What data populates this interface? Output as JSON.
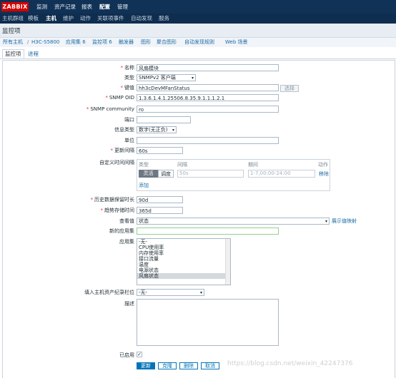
{
  "logo": "ZABBIX",
  "topnav": [
    "监测",
    "资产记录",
    "报表",
    "配置",
    "管理"
  ],
  "subnav": [
    "主机群组",
    "模板",
    "主机",
    "维护",
    "动作",
    "关联项事件",
    "自动发现",
    "服务"
  ],
  "page_title": "监控项",
  "hostbar": {
    "all_hosts": "所有主机",
    "sep": "/",
    "host": "H3C-S5800",
    "apps": "应用集 6",
    "items": "监控项 6",
    "triggers": "触发器",
    "graphs": "图形",
    "screens": "聚合图形",
    "discovery": "自动发现规则",
    "web": "Web 场景"
  },
  "tabs": {
    "item": "监控项",
    "process": "进程"
  },
  "form": {
    "name_label": "名称",
    "name_value": "风扇模块",
    "type_label": "类型",
    "type_value": "SNMPv2 客户端",
    "key_label": "键值",
    "key_value": "hh3cDevMFanStatus",
    "key_select": "选择",
    "oid_label": "SNMP OID",
    "oid_value": "1.3.6.1.4.1.25506.8.35.9.1.1.1.2.1",
    "community_label": "SNMP community",
    "community_value": "ro",
    "port_label": "端口",
    "port_value": "",
    "info_type_label": "信息类型",
    "info_type_value": "数字(无正负)",
    "unit_label": "单位",
    "unit_value": "",
    "interval_label": "更新间隔",
    "interval_value": "60s",
    "custom_label": "自定义时间间隔",
    "custom_head_type": "类型",
    "custom_head_interval": "间隔",
    "custom_head_period": "期间",
    "custom_head_action": "动作",
    "custom_flexible": "灵活",
    "custom_scheduling": "调度",
    "custom_interval_value": "50s",
    "custom_period_value": "1-7,00:00-24:00",
    "custom_remove": "移除",
    "custom_add": "添加",
    "history_label": "历史数据保留时长",
    "history_value": "90d",
    "trend_label": "趋势存储时间",
    "trend_value": "365d",
    "show_value_label": "查看值",
    "show_value_value": "状态",
    "show_value_map": "展示值映射",
    "new_app_label": "新的应用集",
    "new_app_value": "",
    "apps_label": "应用集",
    "apps_options": [
      "-无-",
      "CPU使用率",
      "内存使用率",
      "接口流量",
      "温度",
      "电源状态",
      "风扇状态"
    ],
    "inventory_label": "填入主机资产纪录栏位",
    "inventory_value": "-无-",
    "desc_label": "描述",
    "desc_value": "",
    "enabled_label": "已启用",
    "enabled_mark": "✓"
  },
  "buttons": {
    "update": "更新",
    "clone": "克隆",
    "delete": "删除",
    "cancel": "取消"
  },
  "watermark": "https://blog.csdn.net/weixin_42247376"
}
